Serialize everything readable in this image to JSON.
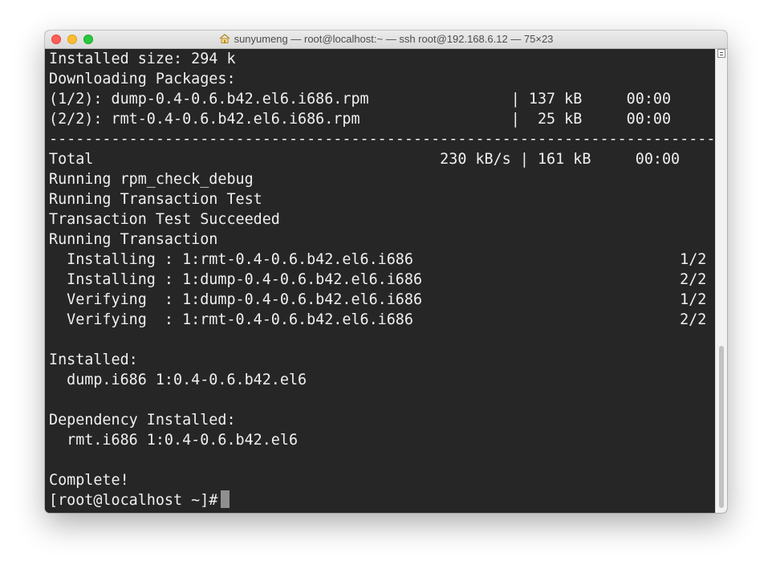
{
  "window": {
    "title": "sunyumeng — root@localhost:~ — ssh root@192.168.6.12 — 75×23",
    "icons": {
      "close": "close-button",
      "minimize": "minimize-button",
      "zoom": "zoom-button",
      "title_icon": "home-icon"
    },
    "colors": {
      "terminal_bg": "#262626",
      "terminal_fg": "#f0f0f0",
      "cursor": "#8f8f8f"
    }
  },
  "terminal": {
    "lines": [
      "Installed size: 294 k",
      "Downloading Packages:",
      "(1/2): dump-0.4-0.6.b42.el6.i686.rpm                | 137 kB     00:00",
      "(2/2): rmt-0.4-0.6.b42.el6.i686.rpm                 |  25 kB     00:00",
      "---------------------------------------------------------------------------",
      "Total                                       230 kB/s | 161 kB     00:00",
      "Running rpm_check_debug",
      "Running Transaction Test",
      "Transaction Test Succeeded",
      "Running Transaction",
      "  Installing : 1:rmt-0.4-0.6.b42.el6.i686                              1/2",
      "  Installing : 1:dump-0.4-0.6.b42.el6.i686                             2/2",
      "  Verifying  : 1:dump-0.4-0.6.b42.el6.i686                             1/2",
      "  Verifying  : 1:rmt-0.4-0.6.b42.el6.i686                              2/2",
      "",
      "Installed:",
      "  dump.i686 1:0.4-0.6.b42.el6",
      "",
      "Dependency Installed:",
      "  rmt.i686 1:0.4-0.6.b42.el6",
      "",
      "Complete!"
    ],
    "prompt": "[root@localhost ~]#"
  }
}
